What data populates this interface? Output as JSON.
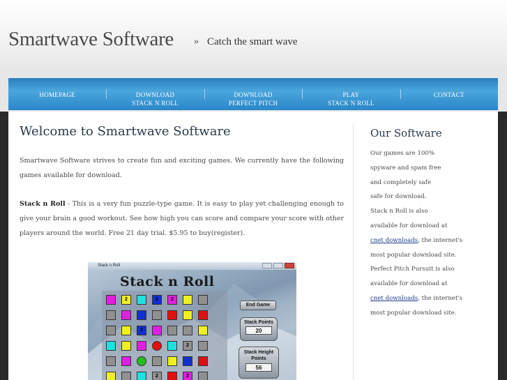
{
  "header": {
    "site_title": "Smartwave Software",
    "separator": "»",
    "tagline": "Catch the smart wave"
  },
  "nav": {
    "items": [
      {
        "line1": "HOMEPAGE",
        "line2": ""
      },
      {
        "line1": "DOWNLOAD",
        "line2": "STACK N ROLL"
      },
      {
        "line1": "DOWNLOAD",
        "line2": "PERFECT PITCH"
      },
      {
        "line1": "PLAY",
        "line2": "STACK N ROLL"
      },
      {
        "line1": "CONTACT",
        "line2": ""
      }
    ]
  },
  "main": {
    "title": "Welcome to Smartwave Software",
    "intro": "Smartwave Software strives to create fun and exciting games. We currently have the following games available for download.",
    "game_name": "Stack n Roll",
    "game_dash": " - ",
    "game_desc": "This is a very fun puzzle-type game. It is easy to play yet challenging enough to give your brain a good workout. See how high you can score and compare your score with other players around the world. Free 21 day trial. $5.95 to buy(register).",
    "screenshot": {
      "window_title": "Stack n Roll",
      "logo": "Stack n Roll",
      "end_game": "End Game",
      "stack_points_label": "Stack Points",
      "stack_points_value": "20",
      "stack_height_label1": "Stack Height",
      "stack_height_label2": "Points",
      "stack_height_value": "56",
      "cell_label": "2"
    }
  },
  "sidebar": {
    "title": "Our Software",
    "lines": [
      "Our games are 100%",
      "spyware and spam free",
      "and completely safe",
      "safe for download.",
      "Stack n Roll is also",
      "available for download at"
    ],
    "link1": "cnet downloads",
    "after_link1": ", the internet's",
    "line_after1": "most popular download site.",
    "lines2": [
      "Perfect Pitch Pursuit is also",
      "available for download at"
    ],
    "link2": "cnet downloads",
    "after_link2": ", the internet's",
    "line_after2": "most popular download site."
  },
  "colors": {
    "nav_blue": "#3a96d4",
    "link": "#1a3d8a",
    "heading": "#2a3a4a"
  }
}
